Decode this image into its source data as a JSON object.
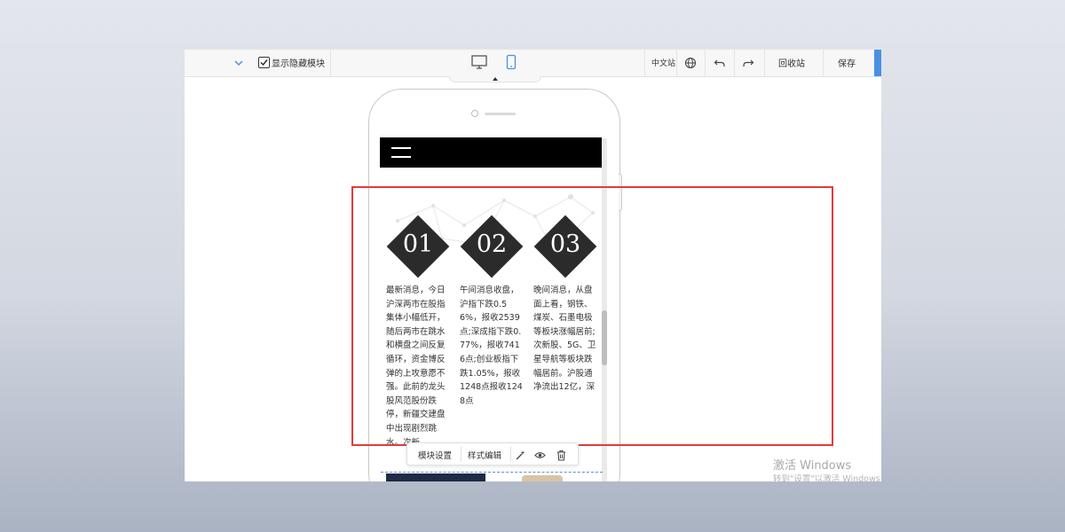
{
  "toolbar": {
    "show_hidden_label": "显示隐藏模块",
    "show_hidden_checked": true,
    "language_label": "中文站",
    "recycle_label": "回收站",
    "save_label": "保存",
    "accent_color": "#4a90e2"
  },
  "phone_screen": {
    "columns": [
      {
        "number": "01",
        "text": "最新消息，今日沪深两市在股指集体小幅低开，随后两市在跳水和横盘之间反复循环，资金博反弹的上攻意愿不强。此前的龙头股风范股份跌停，新疆交建盘中出现剧烈跳水。次新、"
      },
      {
        "number": "02",
        "text": "午间消息收盘，沪指下跌0.56%，报收2539点;深成指下跌0.77%，报收7416点;创业板指下跌1.05%，报收1248点报收1248点"
      },
      {
        "number": "03",
        "text": "晚间消息，从盘面上看，钢铁、煤炭、石墨电极等板块涨幅居前;次新股、5G、卫星导航等板块跌幅居前。沪股通净流出12亿，深"
      }
    ]
  },
  "module_bar": {
    "settings_label": "模块设置",
    "style_label": "样式编辑"
  },
  "watermark": {
    "line1": "激活 Windows",
    "line2": "转到\"设置\"以激活 Windows"
  },
  "colors": {
    "highlight": "#e23b3b",
    "diamond": "#2b2b2b"
  }
}
